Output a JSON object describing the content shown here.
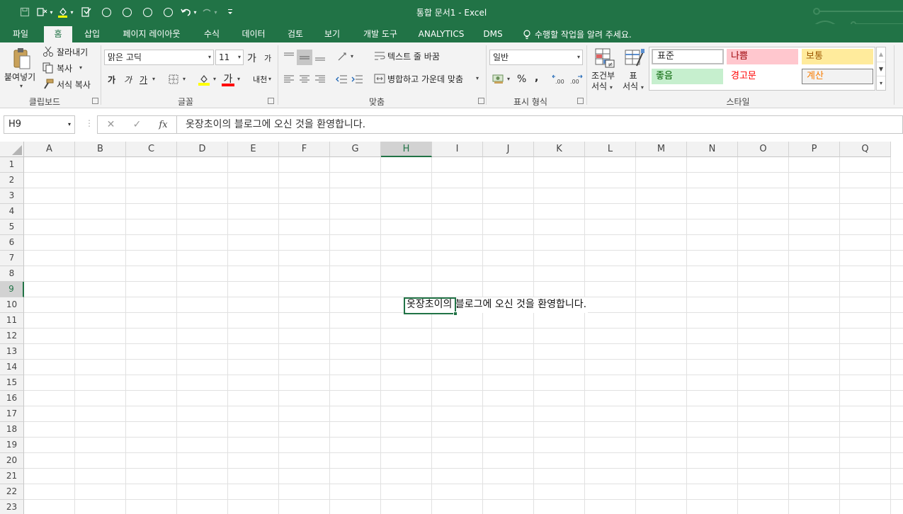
{
  "window": {
    "title": "통합 문서1 - Excel"
  },
  "colors": {
    "accent": "#217346",
    "bad_fill": "#ffc7ce",
    "bad_text": "#9c0006",
    "neutral_fill": "#ffeb9c",
    "neutral_text": "#9c5700",
    "good_fill": "#c6efce",
    "good_text": "#006100",
    "warning_text": "#ff0000",
    "calc_text": "#fa7d00"
  },
  "quick_access": [
    "save-icon",
    "touch-mode-icon",
    "fill-color-icon",
    "spelling-icon",
    "circle-icon",
    "circle-icon",
    "circle-icon",
    "circle-icon",
    "undo-icon",
    "redo-icon",
    "customize-icon"
  ],
  "tabs": [
    "파일",
    "홈",
    "삽입",
    "페이지 레이아웃",
    "수식",
    "데이터",
    "검토",
    "보기",
    "개발 도구",
    "ANALYTICS",
    "DMS"
  ],
  "active_tab": "홈",
  "tell_me": "수행할 작업을 알려 주세요.",
  "ribbon": {
    "clipboard": {
      "paste": "붙여넣기",
      "cut": "잘라내기",
      "copy": "복사",
      "format_painter": "서식 복사",
      "label": "클립보드"
    },
    "font": {
      "name": "맑은 고딕",
      "size": "11",
      "label": "글꼴",
      "grow": "가",
      "shrink": "가",
      "bold": "가",
      "italic": "가",
      "underline": "가",
      "font_color": "가",
      "phonetic": "내천"
    },
    "alignment": {
      "wrap_text": "텍스트 줄 바꿈",
      "merge_center": "병합하고 가운데 맞춤",
      "label": "맞춤"
    },
    "number": {
      "format": "일반",
      "label": "표시 형식",
      "percent": "%",
      "comma": ","
    },
    "styles": {
      "conditional": "조건부\n서식",
      "conditional_line1": "조건부",
      "conditional_line2": "서식",
      "table_line1": "표",
      "table_line2": "서식",
      "cells": [
        "표준",
        "나쁨",
        "보통",
        "좋음",
        "경고문",
        "계산"
      ],
      "label": "스타일"
    }
  },
  "formula_bar": {
    "name_box": "H9",
    "cancel": "✕",
    "enter": "✓",
    "fx": "fx",
    "formula": "옷장초이의 블로그에 오신 것을 환영합니다."
  },
  "grid": {
    "columns": [
      "A",
      "B",
      "C",
      "D",
      "E",
      "F",
      "G",
      "H",
      "I",
      "J",
      "K",
      "L",
      "M",
      "N",
      "O",
      "P",
      "Q"
    ],
    "rows": [
      "1",
      "2",
      "3",
      "4",
      "5",
      "6",
      "7",
      "8",
      "9",
      "10",
      "11",
      "12",
      "13",
      "14",
      "15",
      "16",
      "17",
      "18",
      "19",
      "20",
      "21",
      "22",
      "23"
    ],
    "selected_column": "H",
    "selected_row": "9",
    "cell_value": "옷장초이의 블로그에 오신 것을 환영합니다."
  }
}
